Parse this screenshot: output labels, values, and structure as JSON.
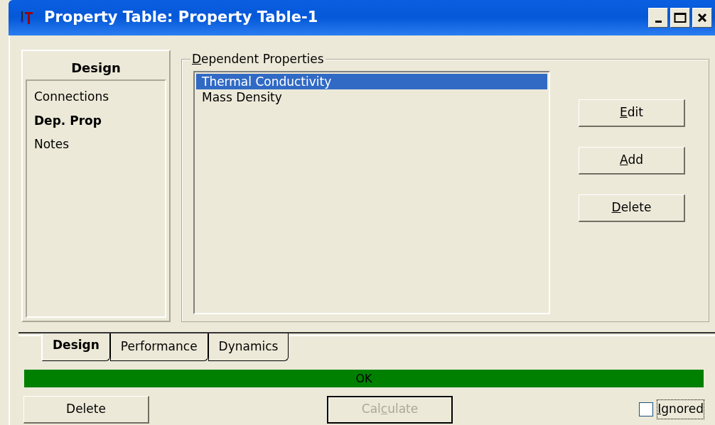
{
  "window": {
    "title": "Property Table: Property Table-1"
  },
  "sidebar": {
    "heading": "Design",
    "items": [
      {
        "label": "Connections",
        "selected": false
      },
      {
        "label": "Dep. Prop",
        "selected": true
      },
      {
        "label": "Notes",
        "selected": false
      }
    ]
  },
  "group": {
    "label": {
      "key": "D",
      "after": "ependent Properties"
    },
    "items": [
      {
        "label": "Thermal Conductivity",
        "selected": true
      },
      {
        "label": "Mass Density",
        "selected": false
      }
    ],
    "buttons": [
      {
        "label": {
          "key": "E",
          "after": "dit"
        },
        "disabled": false
      },
      {
        "label": {
          "key": "A",
          "after": "dd"
        },
        "disabled": false
      },
      {
        "label": {
          "key": "D",
          "after": "elete"
        },
        "disabled": false
      }
    ]
  },
  "tabs": [
    {
      "label": "Design",
      "selected": true
    },
    {
      "label": "Performance",
      "selected": false
    },
    {
      "label": "Dynamics",
      "selected": false
    }
  ],
  "status": {
    "text": "OK",
    "color": "#008000"
  },
  "footer": {
    "buttons": [
      {
        "label": {
          "before": "Delete"
        },
        "disabled": false
      },
      {
        "label": {
          "before": "Cal",
          "key": "c",
          "after": "ulate"
        },
        "disabled": true
      }
    ],
    "checkbox": {
      "label": {
        "key": "I",
        "after": "gnored"
      },
      "checked": false
    }
  }
}
